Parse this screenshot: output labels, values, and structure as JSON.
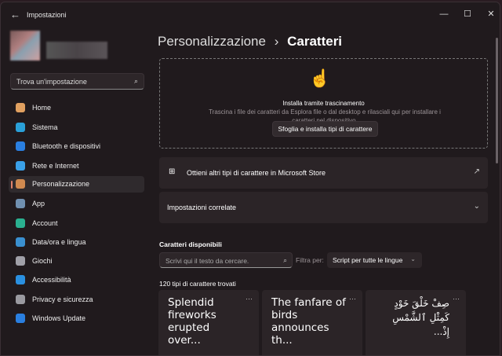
{
  "window": {
    "title": "Impostazioni",
    "back_icon": "arrow-left-icon",
    "minimize": "—",
    "maximize": "☐",
    "close": "✕"
  },
  "sidebar": {
    "search_placeholder": "Trova un'impostazione",
    "items": [
      {
        "label": "Home",
        "color": "#e0a060"
      },
      {
        "label": "Sistema",
        "color": "#2aa0d8"
      },
      {
        "label": "Bluetooth e dispositivi",
        "color": "#2a7fe0"
      },
      {
        "label": "Rete e Internet",
        "color": "#3aa0e8"
      },
      {
        "label": "Personalizzazione",
        "color": "#d08a50",
        "selected": true
      },
      {
        "label": "App",
        "color": "#7090b0"
      },
      {
        "label": "Account",
        "color": "#2ab090"
      },
      {
        "label": "Data/ora e lingua",
        "color": "#3a90d0"
      },
      {
        "label": "Giochi",
        "color": "#a0a0a8"
      },
      {
        "label": "Accessibilità",
        "color": "#2a90e0"
      },
      {
        "label": "Privacy e sicurezza",
        "color": "#9a9aa0"
      },
      {
        "label": "Windows Update",
        "color": "#2a7fe0"
      }
    ]
  },
  "breadcrumb": {
    "parent": "Personalizzazione",
    "sep": "›",
    "current": "Caratteri"
  },
  "dropzone": {
    "title": "Installa tramite trascinamento",
    "description": "Trascina i file dei caratteri da Esplora file o dal desktop e rilasciali qui per installare i caratteri nel dispositivo.",
    "button": "Sfoglia e installa tipi di carattere"
  },
  "store_row": {
    "label": "Ottieni altri tipi di carattere in Microsoft Store"
  },
  "related_row": {
    "label": "Impostazioni correlate"
  },
  "fonts": {
    "heading": "Caratteri disponibili",
    "search_placeholder": "Scrivi qui il testo da cercare.",
    "filter_label": "Filtra per:",
    "filter_value": "Script per tutte le lingue",
    "count": "120 tipi di carattere trovati",
    "cards": [
      {
        "sample": "Splendid fireworks erupted over..."
      },
      {
        "sample": "The fanfare of birds announces th..."
      },
      {
        "sample": "صِفْ خَلْقَ خَوْدٍ كَمِثْلِ ٱلشَّمْسِ إِذْ..."
      }
    ],
    "more": "···"
  }
}
